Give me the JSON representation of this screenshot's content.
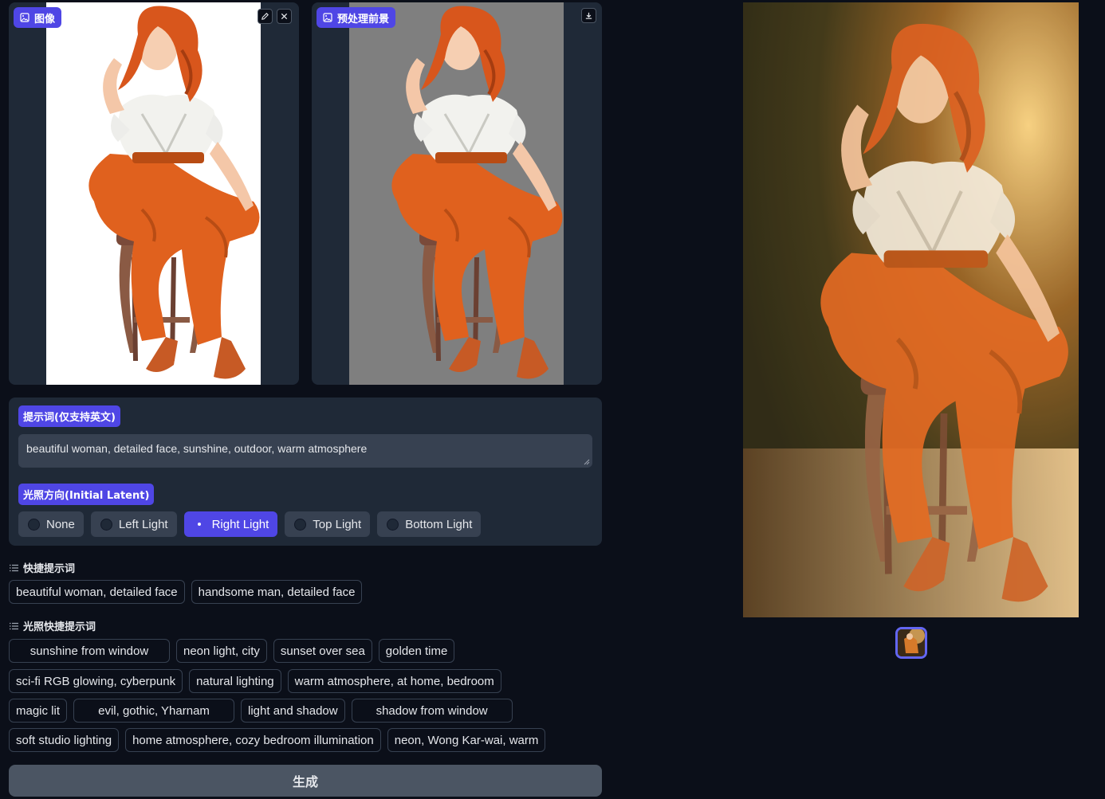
{
  "input_panel": {
    "badge_label": "图像",
    "edit_icon": "pencil-icon",
    "close_icon": "close-icon",
    "image_icon": "image-icon"
  },
  "preprocessed_panel": {
    "badge_label": "预处理前景",
    "download_icon": "download-icon",
    "image_icon": "image-icon"
  },
  "prompt": {
    "label": "提示词(仅支持英文)",
    "value": "beautiful woman, detailed face, sunshine, outdoor, warm atmosphere"
  },
  "lighting": {
    "label": "光照方向(Initial Latent)",
    "options": [
      "None",
      "Left Light",
      "Right Light",
      "Top Light",
      "Bottom Light"
    ],
    "selected": "Right Light"
  },
  "quick_prompts": {
    "heading": "快捷提示词",
    "items": [
      "beautiful woman, detailed face",
      "handsome man, detailed face"
    ]
  },
  "lighting_quick_prompts": {
    "heading": "光照快捷提示词",
    "rows": [
      [
        "sunshine from window",
        "neon light, city",
        "sunset over sea",
        "golden time"
      ],
      [
        "sci-fi RGB glowing, cyberpunk",
        "natural lighting",
        "warm atmosphere, at home, bedroom"
      ],
      [
        "magic lit",
        "evil, gothic, Yharnam",
        "light and shadow",
        "shadow from window"
      ],
      [
        "soft studio lighting",
        "home atmosphere, cozy bedroom illumination",
        "neon, Wong Kar-wai, warm"
      ]
    ]
  },
  "generate_button": "生成",
  "colors": {
    "accent": "#4f46e5",
    "background": "#0b0f19",
    "panel": "#1f2937"
  }
}
